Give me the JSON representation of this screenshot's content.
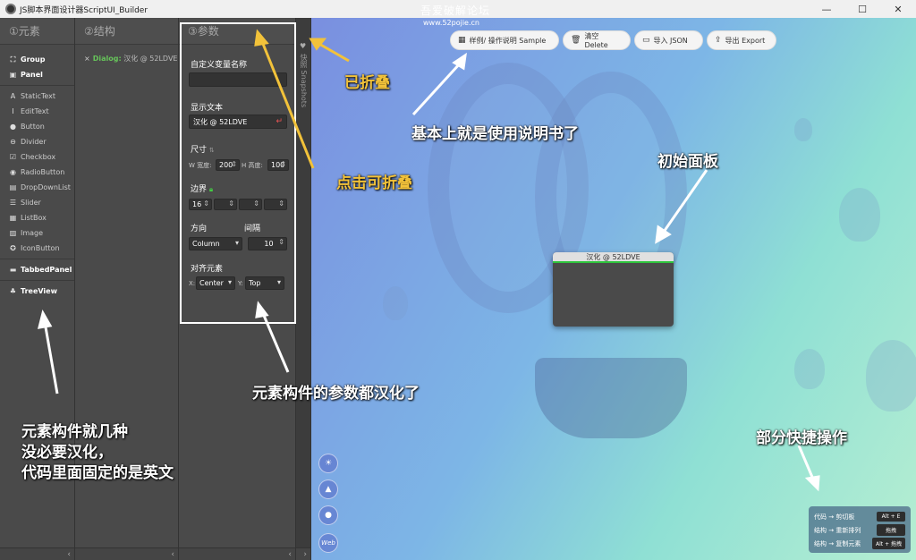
{
  "window": {
    "app_title": "JS脚本界面设计器ScriptUI_Builder",
    "site_title": "吾爱破解论坛",
    "site_url": "www.52pojie.cn",
    "controls": [
      "—",
      "☐",
      "✕"
    ]
  },
  "panes": {
    "elements": {
      "title": "①元素",
      "items": [
        {
          "label": "Group",
          "icon": "group-icon"
        },
        {
          "label": "Panel",
          "icon": "panel-icon"
        },
        {
          "label": "StaticText",
          "icon": "text-icon"
        },
        {
          "label": "EditText",
          "icon": "cursor-icon"
        },
        {
          "label": "Button",
          "icon": "button-icon"
        },
        {
          "label": "Divider",
          "icon": "divider-icon"
        },
        {
          "label": "Checkbox",
          "icon": "checkbox-icon"
        },
        {
          "label": "RadioButton",
          "icon": "radio-icon"
        },
        {
          "label": "DropDownList",
          "icon": "dropdown-icon"
        },
        {
          "label": "Slider",
          "icon": "slider-icon"
        },
        {
          "label": "ListBox",
          "icon": "listbox-icon"
        },
        {
          "label": "Image",
          "icon": "image-icon"
        },
        {
          "label": "IconButton",
          "icon": "iconbutton-icon"
        },
        {
          "label": "TabbedPanel",
          "icon": "folder-icon"
        },
        {
          "label": "TreeView",
          "icon": "tree-icon"
        }
      ]
    },
    "structure": {
      "title": "②结构",
      "tree_item": {
        "kind": "Dialog:",
        "name": "汉化 @ 52LDVE"
      }
    },
    "params": {
      "title": "③参数",
      "var_name_label": "自定义变量名称",
      "var_name_value": "",
      "display_text_label": "显示文本",
      "display_text_value": "汉化 @ 52LDVE",
      "size_label": "尺寸",
      "width_label": "W 宽度:",
      "width_value": "200",
      "height_label": "H 高度:",
      "height_value": "100",
      "border_label": "边界",
      "border_values": [
        "16",
        "",
        "",
        ""
      ],
      "direction_label": "方向",
      "direction_value": "Column",
      "spacing_label": "间隔",
      "spacing_value": "10",
      "align_label": "对齐元素",
      "align_x_label": "X:",
      "align_x_value": "Center",
      "align_y_label": "Y:",
      "align_y_value": "Top"
    },
    "snapshots": {
      "title": "快照 Snapshots"
    }
  },
  "toolbar": {
    "sample": "样例/ 操作说明 Sample",
    "delete": "清空 Delete",
    "import": "导入 JSON",
    "export": "导出 Export"
  },
  "dialog_preview": {
    "title": "汉化 @ 52LDVE"
  },
  "side_buttons": [
    "lightbulb-icon",
    "graduation-cap-icon",
    "github-icon",
    "web-icon"
  ],
  "side_web_label": "Web",
  "shortcuts": [
    {
      "label": "代码 → 剪切板",
      "key": "Alt + E"
    },
    {
      "label": "结构 → 重新排列",
      "key": "拖拽"
    },
    {
      "label": "结构 → 复制元素",
      "key": "Alt + 拖拽"
    }
  ],
  "annotations": {
    "folded": "已折叠",
    "manual": "基本上就是使用说明书了",
    "initial_panel": "初始面板",
    "click_fold": "点击可折叠",
    "params_translated": "元素构件的参数都汉化了",
    "shortcut_ops": "部分快捷操作",
    "elements_note": [
      "元素构件就几种",
      "没必要汉化，",
      "代码里面固定的是英文"
    ]
  }
}
